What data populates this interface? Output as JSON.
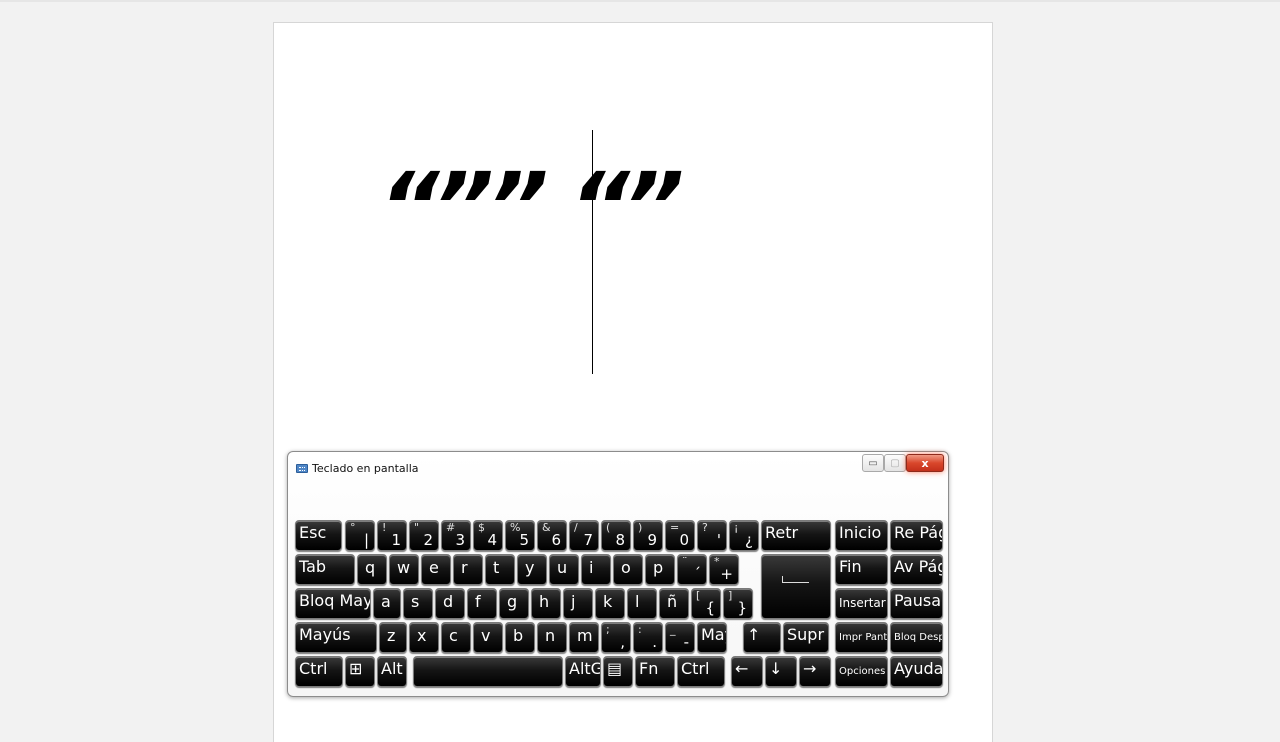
{
  "document": {
    "text": "“”” “”"
  },
  "osk": {
    "title": "Teclado en pantalla",
    "buttons": {
      "minimize": "▭",
      "maximize": "▢",
      "close": "x"
    },
    "rows": {
      "r1": [
        {
          "label": "Esc"
        },
        {
          "shift": "°",
          "main": "|"
        },
        {
          "shift": "!",
          "main": "1"
        },
        {
          "shift": "\"",
          "main": "2"
        },
        {
          "shift": "#",
          "main": "3"
        },
        {
          "shift": "$",
          "main": "4"
        },
        {
          "shift": "%",
          "main": "5"
        },
        {
          "shift": "&",
          "main": "6"
        },
        {
          "shift": "/",
          "main": "7"
        },
        {
          "shift": "(",
          "main": "8"
        },
        {
          "shift": ")",
          "main": "9"
        },
        {
          "shift": "=",
          "main": "0"
        },
        {
          "shift": "?",
          "main": "'"
        },
        {
          "shift": "¡",
          "main": "¿"
        },
        {
          "label": "Retr"
        }
      ],
      "r2": [
        {
          "label": "Tab"
        },
        {
          "char": "q"
        },
        {
          "char": "w"
        },
        {
          "char": "e"
        },
        {
          "char": "r"
        },
        {
          "char": "t"
        },
        {
          "char": "y"
        },
        {
          "char": "u"
        },
        {
          "char": "i"
        },
        {
          "char": "o"
        },
        {
          "char": "p"
        },
        {
          "shift": "¨",
          "main": "´"
        },
        {
          "shift": "*",
          "main": "+"
        }
      ],
      "r3": [
        {
          "label": "Bloq May"
        },
        {
          "char": "a"
        },
        {
          "char": "s"
        },
        {
          "char": "d"
        },
        {
          "char": "f"
        },
        {
          "char": "g"
        },
        {
          "char": "h"
        },
        {
          "char": "j"
        },
        {
          "char": "k"
        },
        {
          "char": "l"
        },
        {
          "char": "ñ"
        },
        {
          "shift": "[",
          "main": "{"
        },
        {
          "shift": "]",
          "main": "}"
        }
      ],
      "r4": [
        {
          "label": "Mayús"
        },
        {
          "char": "z"
        },
        {
          "char": "x"
        },
        {
          "char": "c"
        },
        {
          "char": "v"
        },
        {
          "char": "b"
        },
        {
          "char": "n"
        },
        {
          "char": "m"
        },
        {
          "shift": ";",
          "main": ","
        },
        {
          "shift": ":",
          "main": "."
        },
        {
          "shift": "_",
          "main": "-"
        },
        {
          "label": "Mayús"
        },
        {
          "label": "↑"
        },
        {
          "label": "Supr"
        }
      ],
      "r5": [
        {
          "label": "Ctrl"
        },
        {
          "label": "⊞"
        },
        {
          "label": "Alt"
        },
        {
          "label": ""
        },
        {
          "label": "AltGr"
        },
        {
          "label": "▤"
        },
        {
          "label": "Fn"
        },
        {
          "label": "Ctrl"
        },
        {
          "label": "←"
        },
        {
          "label": "↓"
        },
        {
          "label": "→"
        }
      ]
    },
    "side": {
      "inicio": "Inicio",
      "re_pag": "Re Pág",
      "fin": "Fin",
      "av_pag": "Av Pág",
      "insertar": "Insertar",
      "pausa": "Pausa",
      "impr_pant": "Impr Pant",
      "bloq_despl": "Bloq Despl",
      "opciones": "Opciones",
      "ayuda": "Ayuda"
    }
  }
}
